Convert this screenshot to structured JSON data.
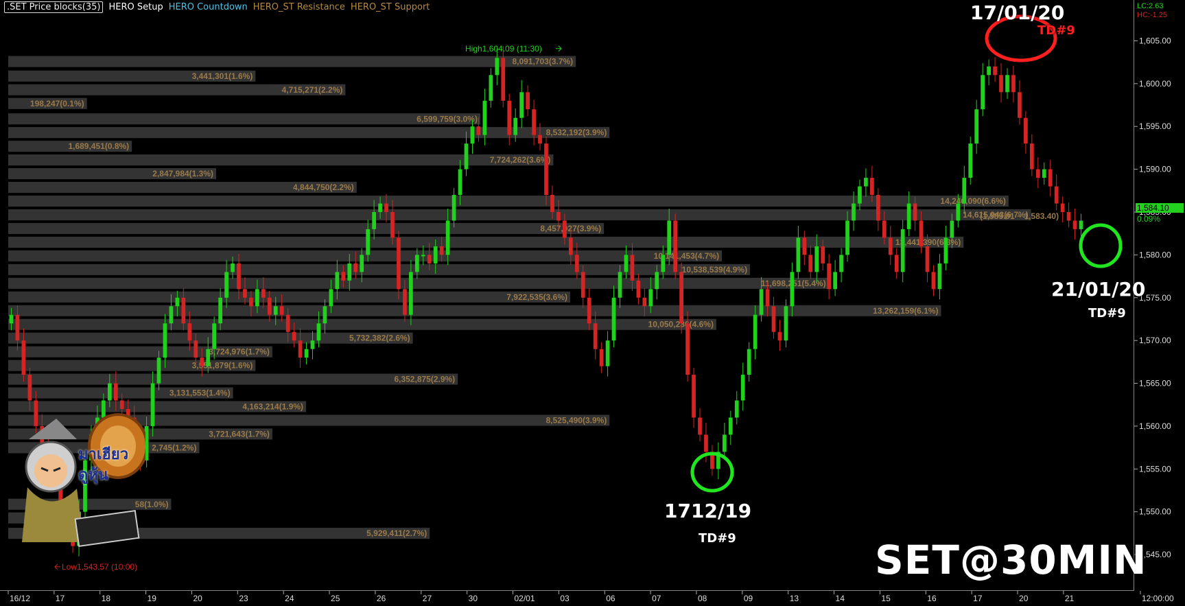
{
  "header": {
    "indicator_box": ".SET Price blocks(35)",
    "items": [
      {
        "label": "HERO Setup",
        "color": "#ffffff"
      },
      {
        "label": "HERO Countdown",
        "color": "#4fc3e8"
      },
      {
        "label": "HERO_ST Resistance",
        "color": "#b58a44"
      },
      {
        "label": "HERO_ST Support",
        "color": "#b58a44"
      }
    ]
  },
  "price_panel": {
    "lc": "LC:2.63",
    "hc": "HC:-1.25",
    "last": "1,584.10",
    "change": "0.09%"
  },
  "annotations": {
    "date_top": "17/01/20",
    "td_top": "TD#9",
    "date_mid": "1712/19",
    "td_mid": "TD#9",
    "date_right": "21/01/20",
    "td_right": "TD#9",
    "watermark": "SET@30MIN",
    "logo_text": "มาเฮียว ดูหุ้น"
  },
  "colors": {
    "up": "#21d11e",
    "down": "#d52424",
    "volume_block": "#333333",
    "block_label": "#9a7a4a",
    "countdown": "#4fc3e8",
    "setup": "#ffffff",
    "circle_red": "#ff1f1f",
    "circle_green": "#1fe61f"
  },
  "chart_data": {
    "type": "candlestick",
    "ylim": [
      1541,
      1608
    ],
    "yticks": [
      "1,605.00",
      "1,600.00",
      "1,595.00",
      "1,590.00",
      "1,585.00",
      "1,580.00",
      "1,575.00",
      "1,570.00",
      "1,565.00",
      "1,560.00",
      "1,555.00",
      "1,550.00",
      "1,545.00"
    ],
    "ytick_values": [
      1605,
      1600,
      1595,
      1590,
      1585,
      1580,
      1575,
      1570,
      1565,
      1560,
      1555,
      1550,
      1545
    ],
    "xlabels": [
      "16/12",
      "17",
      "18",
      "19",
      "20",
      "23",
      "24",
      "25",
      "26",
      "27",
      "30",
      "02/01",
      "03",
      "06",
      "07",
      "08",
      "09",
      "13",
      "14",
      "15",
      "16",
      "17",
      "20",
      "21",
      "12:00:00"
    ],
    "high_label": "High1,604.09 (11:30)",
    "low_label": "Low1,543.57 (10:00)",
    "high": 1604.09,
    "low": 1543.57,
    "current_range": "(1,585.01 ~ 1,583.40)",
    "closes": [
      1573,
      1570,
      1566,
      1563,
      1560,
      1558,
      1557,
      1554,
      1551,
      1548,
      1546,
      1550,
      1556,
      1559,
      1561,
      1563,
      1565,
      1563,
      1562,
      1561,
      1558,
      1556,
      1560,
      1565,
      1568,
      1572,
      1574,
      1575,
      1572,
      1570,
      1568,
      1567,
      1569,
      1572,
      1575,
      1578,
      1579,
      1576,
      1575,
      1574,
      1576,
      1575,
      1573,
      1574,
      1573,
      1571,
      1570,
      1568,
      1569,
      1570,
      1572,
      1574,
      1576,
      1578,
      1577,
      1579,
      1578,
      1580,
      1583,
      1585,
      1586,
      1585,
      1582,
      1576,
      1573,
      1578,
      1580,
      1580,
      1579,
      1581,
      1580,
      1584,
      1587,
      1590,
      1593,
      1595,
      1594,
      1598,
      1601,
      1603,
      1598,
      1594,
      1596,
      1599,
      1597,
      1594,
      1593,
      1587,
      1585,
      1584,
      1582,
      1580,
      1578,
      1575,
      1572,
      1569,
      1567,
      1570,
      1575,
      1578,
      1580,
      1577,
      1575,
      1574,
      1576,
      1578,
      1580,
      1584,
      1578,
      1572,
      1566,
      1561,
      1559,
      1557,
      1555,
      1557,
      1559,
      1561,
      1563,
      1566,
      1569,
      1573,
      1576,
      1574,
      1571,
      1570,
      1574,
      1578,
      1582,
      1580,
      1578,
      1581,
      1579,
      1576,
      1578,
      1580,
      1584,
      1586,
      1588,
      1589,
      1587,
      1584,
      1582,
      1580,
      1578,
      1583,
      1586,
      1584,
      1581,
      1578,
      1576,
      1579,
      1582,
      1584,
      1586,
      1589,
      1593,
      1597,
      1601,
      1602,
      1601,
      1599,
      1601,
      1599,
      1596,
      1593,
      1590,
      1589,
      1590,
      1588,
      1586,
      1585,
      1584,
      1583,
      1584
    ],
    "price_blocks": [
      {
        "label": "8,091,703(3.7%)",
        "price": 1602.5,
        "width": 0.505
      },
      {
        "label": "3,441,301(1.6%)",
        "price": 1600.8,
        "width": 0.22
      },
      {
        "label": "4,715,271(2.2%)",
        "price": 1599.2,
        "width": 0.3
      },
      {
        "label": "198,247(0.1%)",
        "price": 1597.6,
        "width": 0.07
      },
      {
        "label": "6,599,759(3.0%)",
        "price": 1595.8,
        "width": 0.42
      },
      {
        "label": "8,532,192(3.9%)",
        "price": 1594.2,
        "width": 0.535
      },
      {
        "label": "1,689,451(0.8%)",
        "price": 1592.6,
        "width": 0.11
      },
      {
        "label": "7,724,262(3.6%)",
        "price": 1591.0,
        "width": 0.485
      },
      {
        "label": "2,847,984(1.3%)",
        "price": 1589.4,
        "width": 0.185
      },
      {
        "label": "4,844,750(2.2%)",
        "price": 1587.8,
        "width": 0.31
      },
      {
        "label": "14,246,090(6.6%)",
        "price": 1586.2,
        "width": 0.89
      },
      {
        "label": "14,615,943(6.7%)",
        "price": 1584.6,
        "width": 0.91
      },
      {
        "label": "8,457,027(3.9%)",
        "price": 1583.0,
        "width": 0.53
      },
      {
        "label": "13,441,390(6.3%)",
        "price": 1581.4,
        "width": 0.85
      },
      {
        "label": "10,141,453(4.7%)",
        "price": 1579.8,
        "width": 0.635
      },
      {
        "label": "10,538,539(4.9%)",
        "price": 1578.2,
        "width": 0.66
      },
      {
        "label": "11,698,251(5.4%)",
        "price": 1576.6,
        "width": 0.73
      },
      {
        "label": "7,922,535(3.6%)",
        "price": 1575.0,
        "width": 0.5
      },
      {
        "label": "13,262,159(6.1%)",
        "price": 1573.4,
        "width": 0.83
      },
      {
        "label": "10,050,236(4.6%)",
        "price": 1571.8,
        "width": 0.63
      },
      {
        "label": "5,732,382(2.6%)",
        "price": 1570.2,
        "width": 0.36
      },
      {
        "label": "3,724,976(1.7%)",
        "price": 1568.6,
        "width": 0.235
      },
      {
        "label": "3,551,879(1.6%)",
        "price": 1567.0,
        "width": 0.22
      },
      {
        "label": "6,352,875(2.9%)",
        "price": 1565.4,
        "width": 0.4
      },
      {
        "label": "3,131,553(1.4%)",
        "price": 1563.8,
        "width": 0.2
      },
      {
        "label": "4,163,214(1.9%)",
        "price": 1562.2,
        "width": 0.265
      },
      {
        "label": "8,525,490(3.9%)",
        "price": 1560.6,
        "width": 0.535
      },
      {
        "label": "3,721,643(1.7%)",
        "price": 1559.0,
        "width": 0.235
      },
      {
        "label": "2,745(1.2%)",
        "price": 1557.4,
        "width": 0.17
      },
      {
        "label": "58(1.0%)",
        "price": 1550.8,
        "width": 0.145
      },
      {
        "label": "643",
        "price": 1549.2,
        "width": 0.04
      },
      {
        "label": "5,929,411(2.7%)",
        "price": 1547.4,
        "width": 0.375
      }
    ]
  }
}
